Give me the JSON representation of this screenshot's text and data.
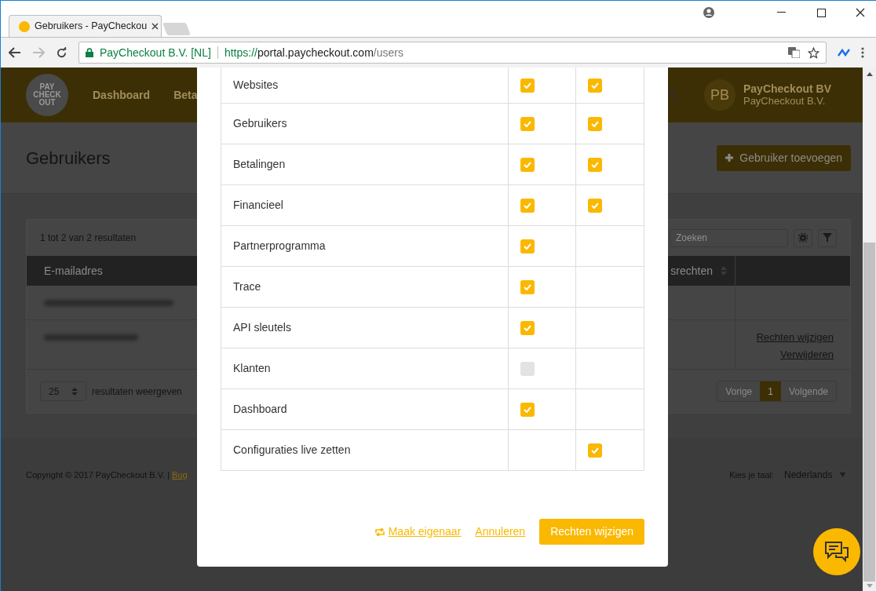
{
  "browser": {
    "tab_title": "Gebruikers - PayCheckou",
    "site_identity": "PayCheckout B.V. [NL]",
    "url": {
      "scheme": "https://",
      "host": "portal.paycheckout.com",
      "path": "/users"
    }
  },
  "header": {
    "logo_lines": [
      "PAY",
      "CHECK",
      "OUT"
    ],
    "nav": [
      "Dashboard",
      "Beta"
    ],
    "avatar": "PB",
    "account_name": "PayCheckout BV",
    "account_company": "PayCheckout B.V."
  },
  "page": {
    "title": "Gebruikers",
    "add_button": "Gebruiker toevoegen"
  },
  "table_card": {
    "result_count": "1 tot 2 van 2 resultaten",
    "search": {
      "placeholder": "Zoeken"
    },
    "columns": [
      "E-mailadres",
      "srechten"
    ],
    "rows": [
      {
        "links": []
      },
      {
        "links": [
          "Rechten wijzigen",
          "Verwijderen"
        ]
      }
    ],
    "page_size": "25",
    "page_size_label": "resultaten weergeven",
    "pagination": [
      {
        "label": "Vorige",
        "selected": false
      },
      {
        "label": "1",
        "selected": true
      },
      {
        "label": "Volgende",
        "selected": false
      }
    ]
  },
  "footer": {
    "copyright": "Copyright © 2017 PayCheckout B.V. |",
    "link": "Bug",
    "language_label": "Kies je taal:",
    "language": "Nederlands"
  },
  "modal": {
    "permissions": [
      {
        "label": "Websites",
        "checkbox_1": {
          "checked": true
        },
        "checkbox_2": {
          "checked": true
        }
      },
      {
        "label": "Gebruikers",
        "checkbox_1": {
          "checked": true
        },
        "checkbox_2": {
          "checked": true
        }
      },
      {
        "label": "Betalingen",
        "checkbox_1": {
          "checked": true
        },
        "checkbox_2": {
          "checked": true
        }
      },
      {
        "label": "Financieel",
        "checkbox_1": {
          "checked": true
        },
        "checkbox_2": {
          "checked": true
        }
      },
      {
        "label": "Partnerprogramma",
        "checkbox_1": {
          "checked": true
        }
      },
      {
        "label": "Trace",
        "checkbox_1": {
          "checked": true
        }
      },
      {
        "label": "API sleutels",
        "checkbox_1": {
          "checked": true
        }
      },
      {
        "label": "Klanten",
        "checkbox_1": {
          "checked": false
        }
      },
      {
        "label": "Dashboard",
        "checkbox_1": {
          "checked": true
        }
      },
      {
        "label": "Configuraties live zetten",
        "checkbox_2": {
          "checked": true
        }
      }
    ],
    "make_owner": "Maak eigenaar",
    "cancel": "Annuleren",
    "submit": "Rechten wijzigen"
  }
}
